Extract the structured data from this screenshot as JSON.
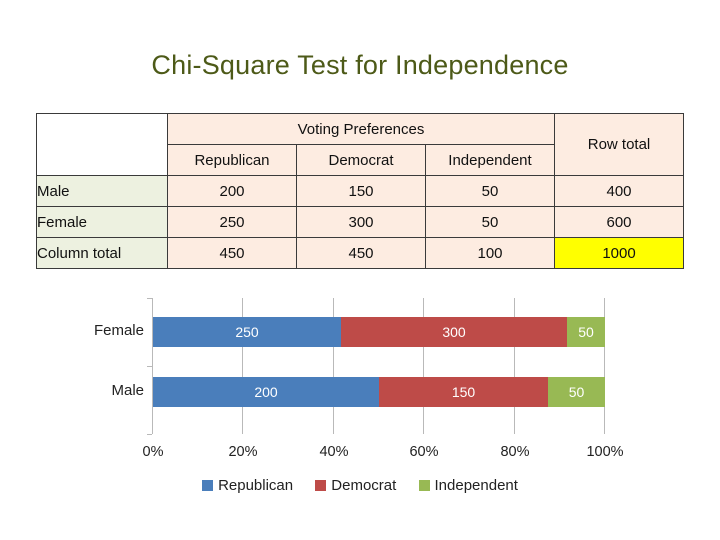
{
  "title": "Chi-Square Test for Independence",
  "table": {
    "corner": "",
    "group_header": "Voting Preferences",
    "row_total_header": "Row total",
    "columns": [
      "Republican",
      "Democrat",
      "Independent"
    ],
    "rows": [
      {
        "label": "Male",
        "values": [
          "200",
          "150",
          "50"
        ],
        "total": "400"
      },
      {
        "label": "Female",
        "values": [
          "250",
          "300",
          "50"
        ],
        "total": "600"
      },
      {
        "label": "Column total",
        "values": [
          "450",
          "450",
          "100"
        ],
        "total": "1000"
      }
    ],
    "colors": {
      "header_fill": "#fdece1",
      "row_label_fill": "#edf1e0",
      "grand_total_fill": "#ffff00",
      "border": "#3a3a3a"
    }
  },
  "chart_data": {
    "type": "bar",
    "orientation": "horizontal",
    "stacked": true,
    "stack_mode": "percent",
    "title": "",
    "xlabel": "",
    "ylabel": "",
    "categories": [
      "Male",
      "Female"
    ],
    "series": [
      {
        "name": "Republican",
        "values": [
          200,
          250
        ],
        "color": "#4a7ebb"
      },
      {
        "name": "Democrat",
        "values": [
          150,
          300
        ],
        "color": "#be4b48"
      },
      {
        "name": "Independent",
        "values": [
          50,
          50
        ],
        "color": "#98b954"
      }
    ],
    "xticks": [
      "0%",
      "20%",
      "40%",
      "60%",
      "80%",
      "100%"
    ],
    "xlim": [
      0,
      100
    ],
    "grid": true,
    "legend_position": "bottom",
    "data_labels": {
      "Female": [
        "250",
        "300",
        "50"
      ],
      "Male": [
        "200",
        "150",
        "50"
      ]
    }
  }
}
